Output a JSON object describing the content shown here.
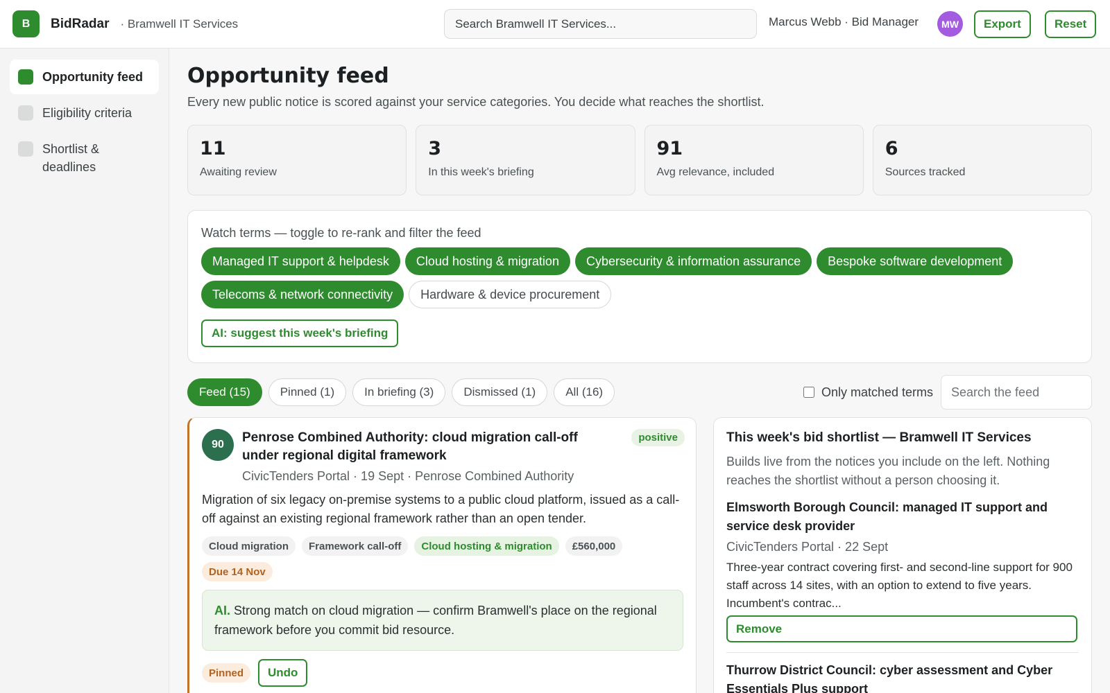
{
  "header": {
    "logo_letter": "B",
    "brand": "BidRadar",
    "org": "· Bramwell IT Services",
    "search_placeholder": "Search Bramwell IT Services...",
    "user": "Marcus Webb · Bid Manager",
    "avatar_initials": "MW",
    "export_label": "Export",
    "reset_label": "Reset"
  },
  "sidebar": {
    "items": [
      {
        "label": "Opportunity feed",
        "active": true
      },
      {
        "label": "Eligibility criteria",
        "active": false
      },
      {
        "label": "Shortlist & deadlines",
        "active": false
      }
    ]
  },
  "page": {
    "title": "Opportunity feed",
    "subtitle": "Every new public notice is scored against your service categories. You decide what reaches the shortlist."
  },
  "stats": [
    {
      "value": "11",
      "label": "Awaiting review"
    },
    {
      "value": "3",
      "label": "In this week's briefing"
    },
    {
      "value": "91",
      "label": "Avg relevance, included"
    },
    {
      "value": "6",
      "label": "Sources tracked"
    }
  ],
  "watch": {
    "label": "Watch terms — toggle to re-rank and filter the feed",
    "terms": [
      {
        "label": "Managed IT support & helpdesk",
        "on": true
      },
      {
        "label": "Cloud hosting & migration",
        "on": true
      },
      {
        "label": "Cybersecurity & information assurance",
        "on": true
      },
      {
        "label": "Bespoke software development",
        "on": true
      },
      {
        "label": "Telecoms & network connectivity",
        "on": true
      },
      {
        "label": "Hardware & device procurement",
        "on": false
      }
    ],
    "ai_button": "AI: suggest this week's briefing"
  },
  "tabs": [
    {
      "label": "Feed (15)",
      "on": true
    },
    {
      "label": "Pinned (1)",
      "on": false
    },
    {
      "label": "In briefing (3)",
      "on": false
    },
    {
      "label": "Dismissed (1)",
      "on": false
    },
    {
      "label": "All (16)",
      "on": false
    }
  ],
  "filters": {
    "only_matched_label": "Only matched terms",
    "feed_search_placeholder": "Search the feed"
  },
  "opportunity": {
    "score": "90",
    "sentiment": "positive",
    "title": "Penrose Combined Authority: cloud migration call-off under regional digital framework",
    "meta": "CivicTenders Portal · 19 Sept · Penrose Combined Authority",
    "description": "Migration of six legacy on-premise systems to a public cloud platform, issued as a call-off against an existing regional framework rather than an open tender.",
    "tags": [
      {
        "label": "Cloud migration",
        "kind": "plain"
      },
      {
        "label": "Framework call-off",
        "kind": "plain"
      },
      {
        "label": "Cloud hosting & migration",
        "kind": "match"
      },
      {
        "label": "£560,000",
        "kind": "plain"
      },
      {
        "label": "Due 14 Nov",
        "kind": "due"
      }
    ],
    "ai_prefix": "AI.",
    "ai_note": "Strong match on cloud migration — confirm Bramwell's place on the regional framework before you commit bid resource.",
    "status": "Pinned",
    "undo_label": "Undo"
  },
  "shortlist": {
    "title": "This week's bid shortlist — Bramwell IT Services",
    "subtitle": "Builds live from the notices you include on the left. Nothing reaches the shortlist without a person choosing it.",
    "items": [
      {
        "title": "Elmsworth Borough Council: managed IT support and service desk provider",
        "meta": "CivicTenders Portal · 22 Sept",
        "description": "Three-year contract covering first- and second-line support for 900 staff across 14 sites, with an option to extend to five years. Incumbent's contrac...",
        "remove_label": "Remove"
      },
      {
        "title": "Thurrow District Council: cyber assessment and Cyber Essentials Plus support"
      }
    ]
  }
}
